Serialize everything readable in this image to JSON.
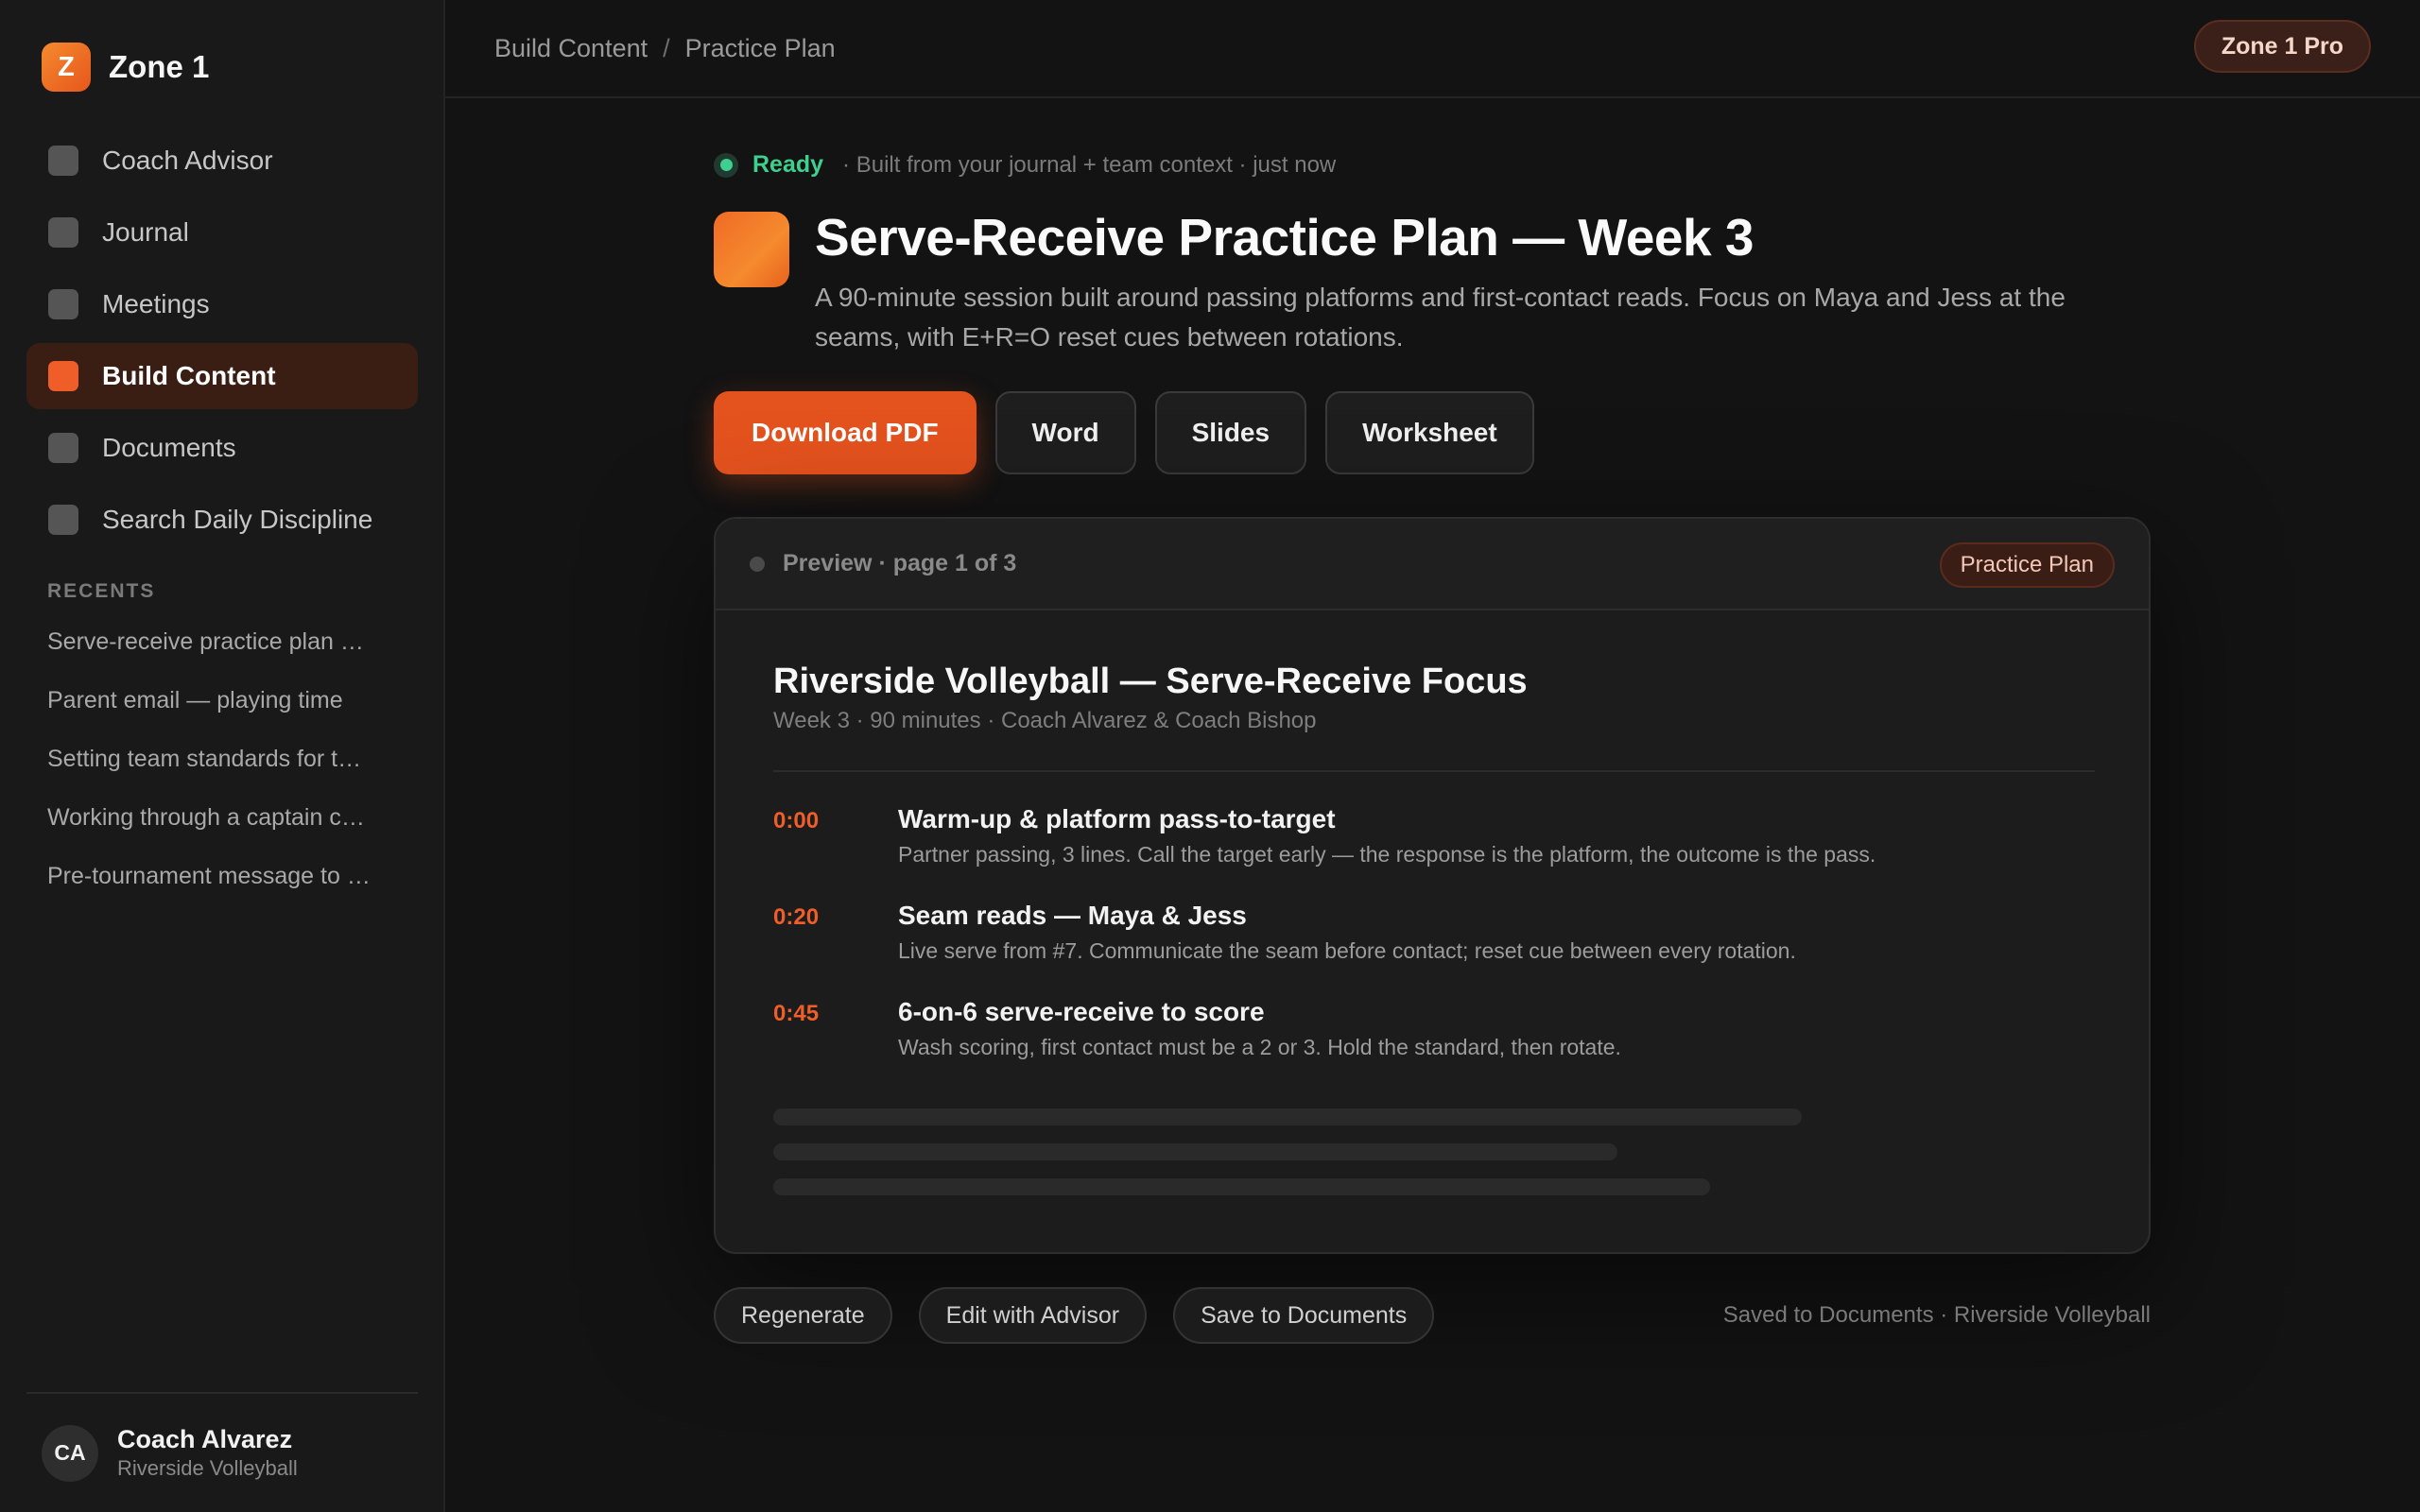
{
  "app": {
    "logo_letter": "Z",
    "name": "Zone 1"
  },
  "sidebar": {
    "nav": [
      {
        "label": "Coach Advisor",
        "active": false
      },
      {
        "label": "Journal",
        "active": false
      },
      {
        "label": "Meetings",
        "active": false
      },
      {
        "label": "Build Content",
        "active": true
      },
      {
        "label": "Documents",
        "active": false
      },
      {
        "label": "Search Daily Discipline",
        "active": false
      }
    ],
    "recents_title": "RECENTS",
    "recents": [
      "Serve-receive practice plan …",
      "Parent email — playing time",
      "Setting team standards for t…",
      "Working through a captain c…",
      "Pre-tournament message to …"
    ],
    "user": {
      "initials": "CA",
      "name": "Coach Alvarez",
      "team": "Riverside Volleyball"
    }
  },
  "topbar": {
    "breadcrumb": [
      "Build Content",
      "Practice Plan"
    ],
    "separator": "/",
    "plan_badge": "Zone 1 Pro"
  },
  "content": {
    "status": "Ready",
    "status_meta": "· Built from your journal + team context · just now",
    "title": "Serve-Receive Practice Plan — Week 3",
    "description": "A 90-minute session built around passing platforms and first-contact reads. Focus on Maya and Jess at the seams, with E+R=O reset cues between rotations.",
    "actions": {
      "download_pdf": "Download PDF",
      "word": "Word",
      "slides": "Slides",
      "worksheet": "Worksheet"
    }
  },
  "preview": {
    "label": "Preview · page 1 of 3",
    "badge": "Practice Plan",
    "doc_title": "Riverside Volleyball — Serve-Receive Focus",
    "doc_meta": "Week 3 · 90 minutes · Coach Alvarez & Coach Bishop",
    "rows": [
      {
        "time": "0:00",
        "title": "Warm-up & platform pass-to-target",
        "desc": "Partner passing, 3 lines. Call the target early — the response is the platform, the outcome is the pass."
      },
      {
        "time": "0:20",
        "title": "Seam reads — Maya & Jess",
        "desc": "Live serve from #7. Communicate the seam before contact; reset cue between every rotation."
      },
      {
        "time": "0:45",
        "title": "6-on-6 serve-receive to score",
        "desc": "Wash scoring, first contact must be a 2 or 3. Hold the standard, then rotate."
      }
    ]
  },
  "footer": {
    "regenerate": "Regenerate",
    "edit": "Edit with Advisor",
    "save": "Save to Documents",
    "saved_note": "Saved to Documents · Riverside Volleyball"
  },
  "colors": {
    "accent": "#e4521e",
    "ready": "#3fcf8e",
    "background": "#131313",
    "sidebar": "#191919"
  }
}
